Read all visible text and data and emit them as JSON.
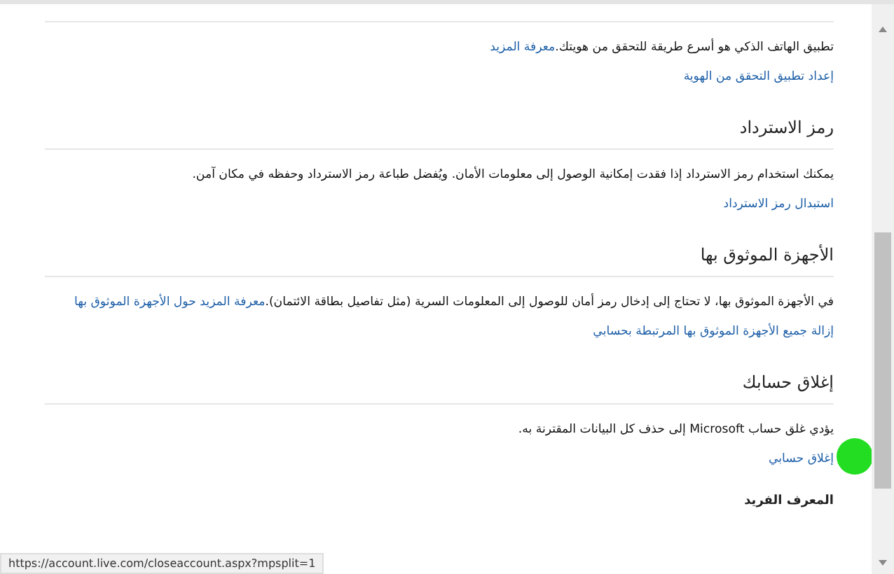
{
  "sections": [
    {
      "text": "تطبيق الهاتف الذكي هو أسرع طريقة للتحقق من هويتك.",
      "inline_link": "معرفة المزيد",
      "link": "إعداد تطبيق التحقق من الهوية"
    },
    {
      "heading": "رمز الاسترداد",
      "text": "يمكنك استخدام رمز الاسترداد إذا فقدت إمكانية الوصول إلى معلومات الأمان. ويُفضل طباعة رمز الاسترداد وحفظه في مكان آمن.",
      "link": "استبدال رمز الاسترداد"
    },
    {
      "heading": "الأجهزة الموثوق بها",
      "text": "في الأجهزة الموثوق بها، لا تحتاج إلى إدخال رمز أمان للوصول إلى المعلومات السرية (مثل تفاصيل بطاقة الائتمان).",
      "inline_link": "معرفة المزيد حول الأجهزة الموثوق بها",
      "link": "إزالة جميع الأجهزة الموثوق بها المرتبطة بحسابي"
    },
    {
      "heading": "إغلاق حسابك",
      "text": "يؤدي غلق حساب Microsoft إلى حذف كل البيانات المقترنة به.",
      "link": "إغلاق حسابي"
    }
  ],
  "next_heading": "المعرف الفريد",
  "status_bar": "https://account.live.com/closeaccount.aspx?mpsplit=1"
}
